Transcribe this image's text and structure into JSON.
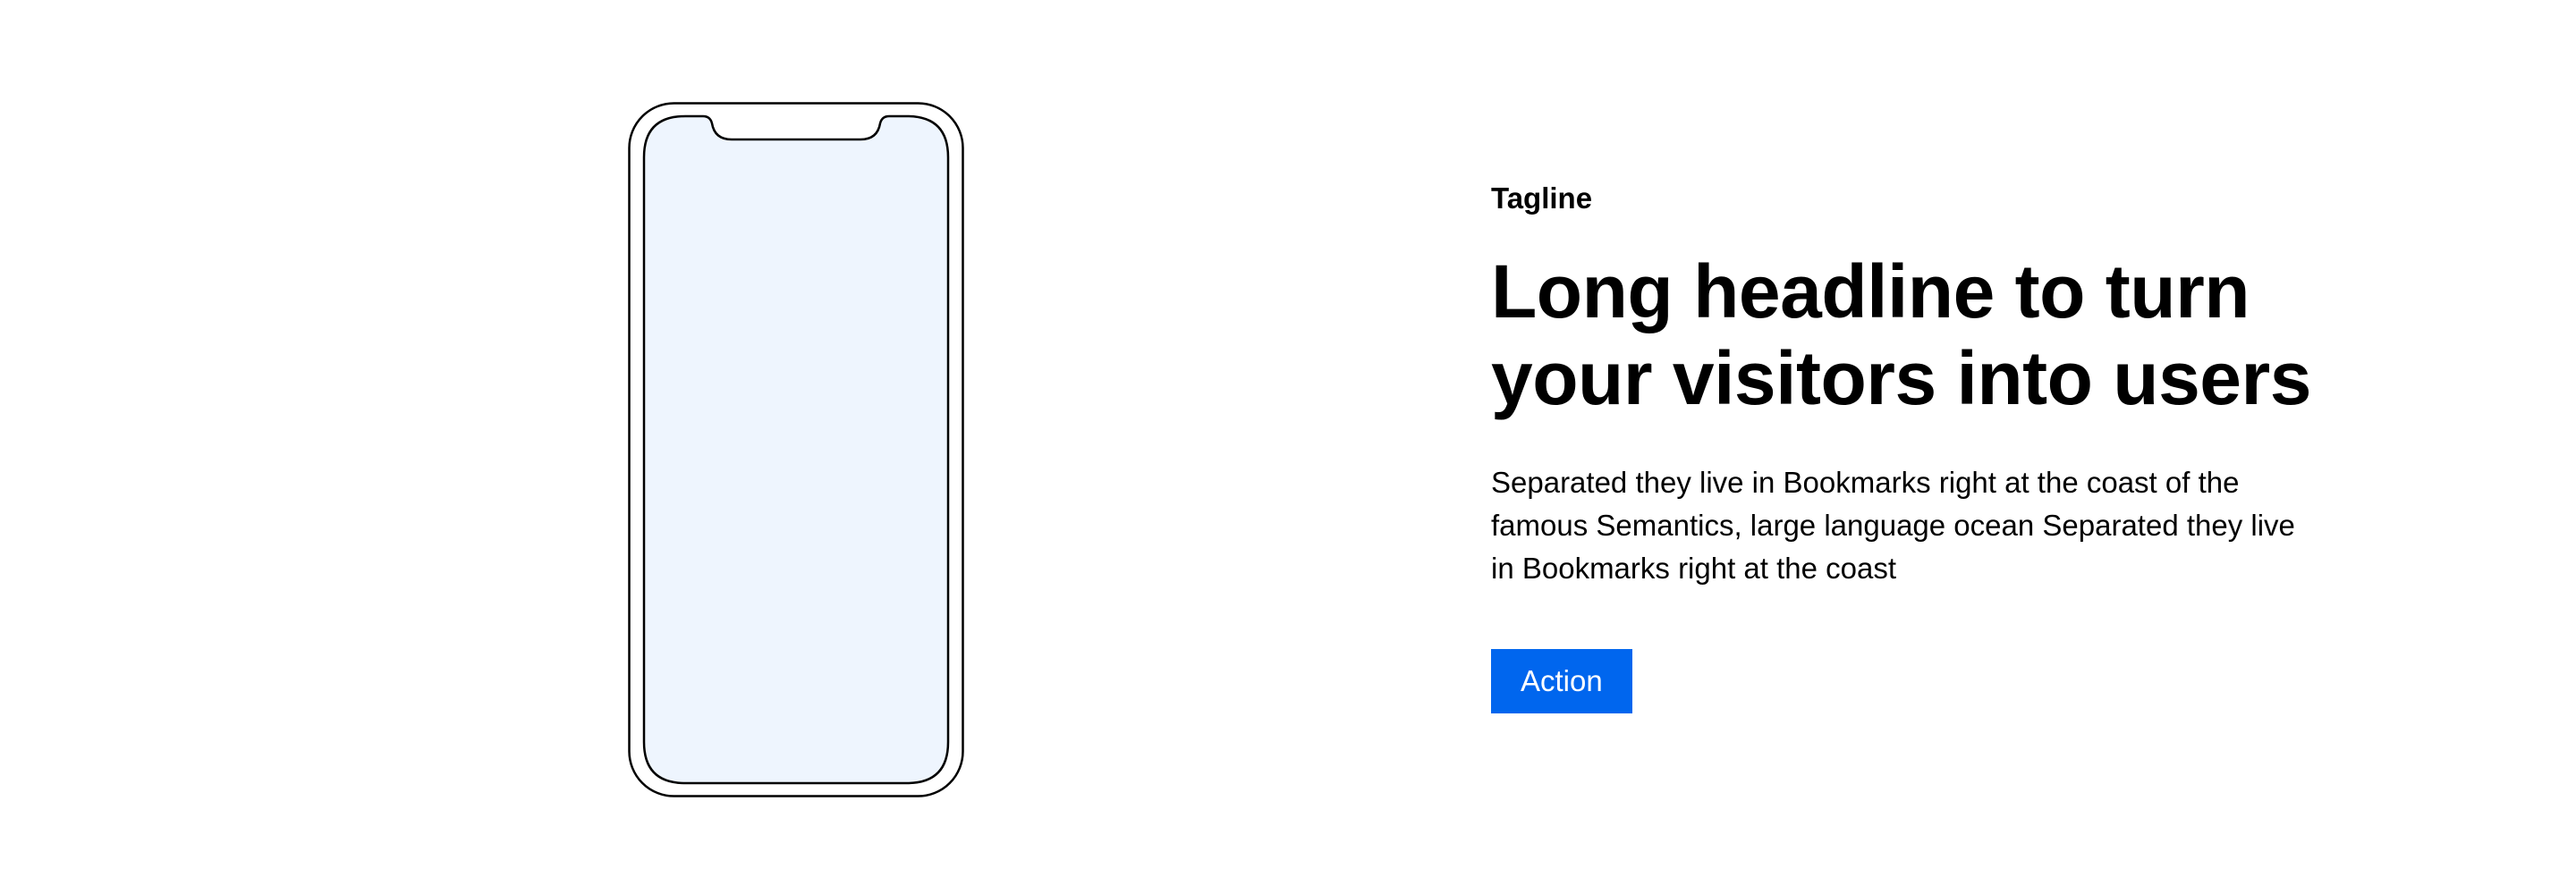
{
  "hero": {
    "tagline": "Tagline",
    "headline": "Long headline to turn your visitors into users",
    "body": "Separated they live in Bookmarks right at the coast of the famous Semantics, large language ocean Separated they live in Bookmarks right at the coast",
    "action_label": "Action"
  },
  "colors": {
    "accent": "#0066ee",
    "screen": "#eef5fe",
    "outline": "#000000"
  },
  "icons": {
    "phone": "phone-mockup-icon"
  }
}
